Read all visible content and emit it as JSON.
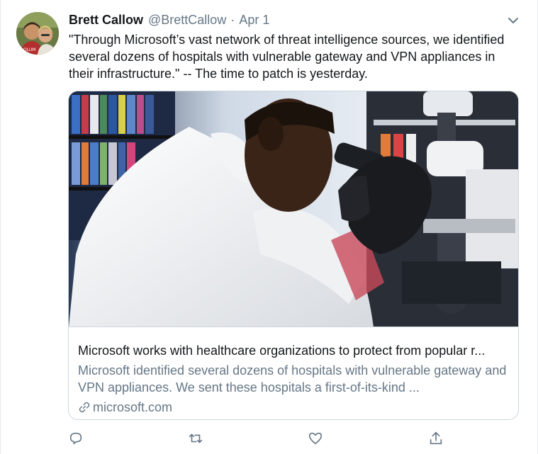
{
  "tweet": {
    "author_name": "Brett Callow",
    "handle": "@BrettCallow",
    "separator": "·",
    "date": "Apr 1",
    "text": "\"Through Microsoft’s vast network of threat intelligence sources, we identified several dozens of hospitals with vulnerable gateway and VPN appliances in their infrastructure.\" -- The time to patch is yesterday."
  },
  "card": {
    "title": "Microsoft works with healthcare organizations to protect from popular r...",
    "description": "Microsoft identified several dozens of hospitals with vulnerable gateway and VPN appliances. We sent these hospitals a first-of-its-kind ...",
    "domain": "microsoft.com"
  },
  "icons": {
    "caret": "chevron-down-icon",
    "reply": "reply-icon",
    "retweet": "retweet-icon",
    "like": "heart-icon",
    "share": "share-icon",
    "link": "link-icon"
  },
  "colors": {
    "primary_text": "#14171a",
    "secondary_text": "#657786",
    "border": "#ccd6dd"
  }
}
